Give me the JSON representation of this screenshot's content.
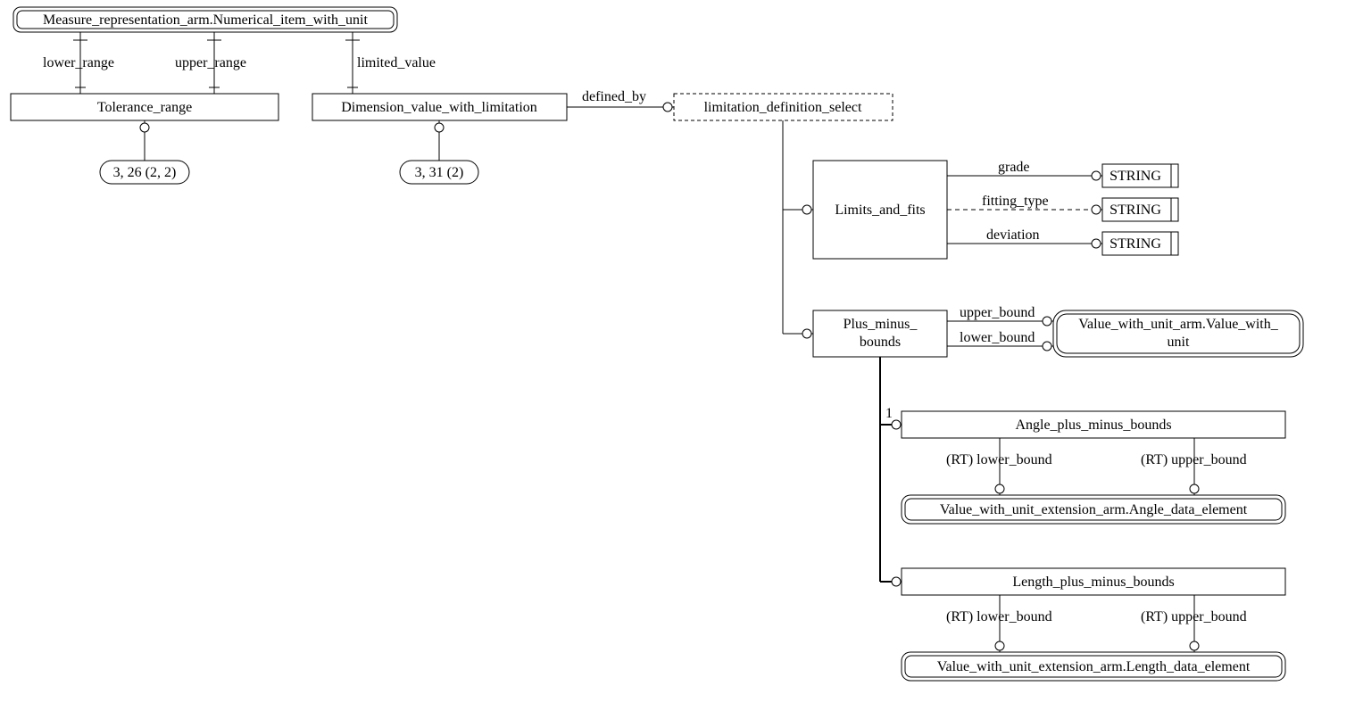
{
  "top_schema_entity": "Measure_representation_arm.Numerical_item_with_unit",
  "tolerance_range": {
    "name": "Tolerance_range",
    "lower_label": "lower_range",
    "upper_label": "upper_range",
    "page_ref": "3, 26 (2, 2)"
  },
  "dimension_value_with_limitation": {
    "name": "Dimension_value_with_limitation",
    "limited_value_label": "limited_value",
    "defined_by_label": "defined_by",
    "page_ref": "3, 31 (2)"
  },
  "limitation_select": "limitation_definition_select",
  "limits_and_fits": {
    "name": "Limits_and_fits",
    "grade": "grade",
    "fitting_type": "fitting_type",
    "deviation": "deviation",
    "string_type": "STRING"
  },
  "plus_minus_bounds": {
    "line1": "Plus_minus_",
    "line2": "bounds",
    "upper_bound": "upper_bound",
    "lower_bound": "lower_bound"
  },
  "value_with_unit": {
    "line1": "Value_with_unit_arm.Value_with_",
    "line2": "unit"
  },
  "angle_pmb": {
    "name": "Angle_plus_minus_bounds",
    "rt_lower": "(RT) lower_bound",
    "rt_upper": "(RT) upper_bound",
    "target": "Value_with_unit_extension_arm.Angle_data_element"
  },
  "length_pmb": {
    "name": "Length_plus_minus_bounds",
    "rt_lower": "(RT) lower_bound",
    "rt_upper": "(RT) upper_bound",
    "target": "Value_with_unit_extension_arm.Length_data_element"
  },
  "one_label": "1"
}
